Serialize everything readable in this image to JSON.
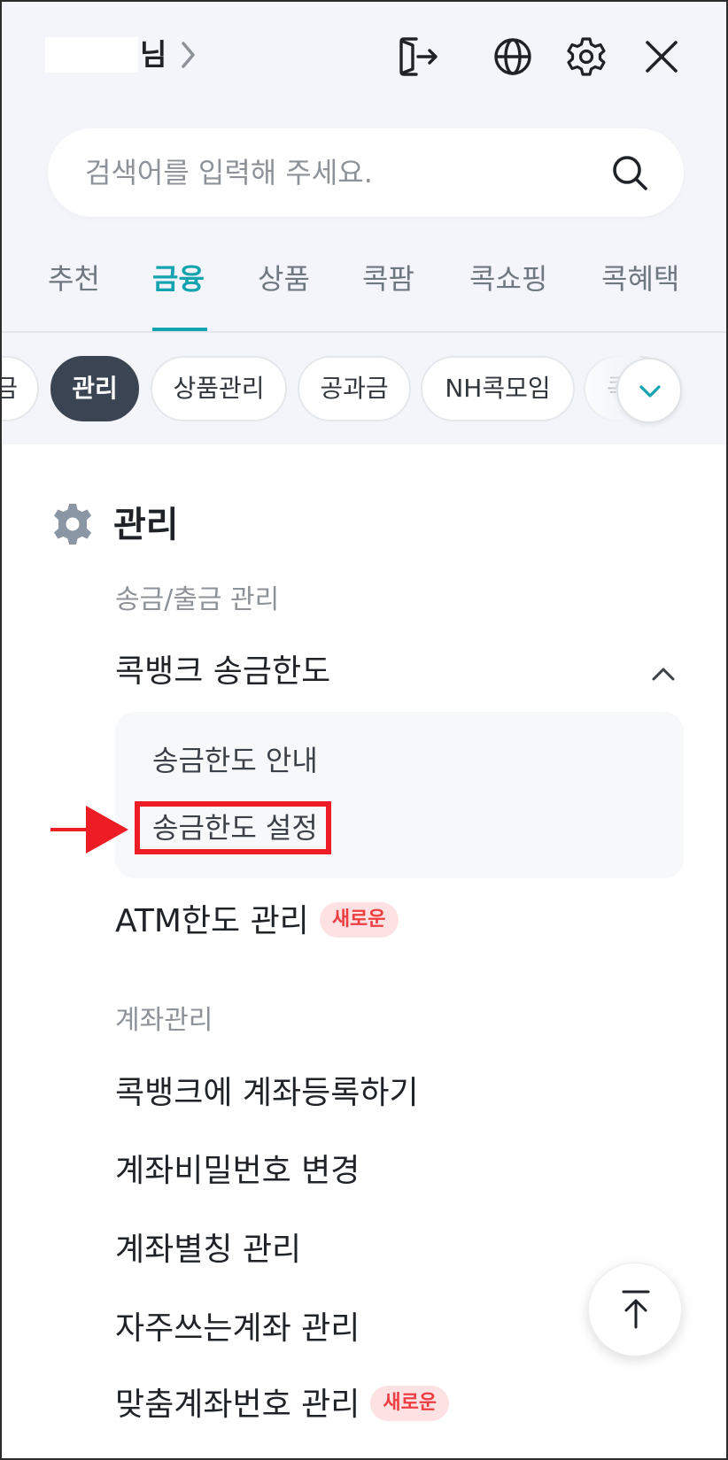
{
  "header": {
    "user_suffix": "님",
    "icons": [
      "logout-icon",
      "globe-icon",
      "settings-icon",
      "close-icon"
    ]
  },
  "search": {
    "placeholder": "검색어를 입력해 주세요."
  },
  "tabs": [
    {
      "label": "추천",
      "active": false
    },
    {
      "label": "금융",
      "active": true
    },
    {
      "label": "상품",
      "active": false
    },
    {
      "label": "콕팜",
      "active": false
    },
    {
      "label": "콕쇼핑",
      "active": false
    },
    {
      "label": "콕혜택",
      "active": false
    }
  ],
  "chips": [
    {
      "label": "금",
      "active": false
    },
    {
      "label": "관리",
      "active": true
    },
    {
      "label": "상품관리",
      "active": false
    },
    {
      "label": "공과금",
      "active": false
    },
    {
      "label": "NH콕모임",
      "active": false
    },
    {
      "label": "콕",
      "active": false
    }
  ],
  "section": {
    "title": "관리",
    "groups": [
      {
        "heading": "송금/출금 관리",
        "items": [
          {
            "label": "콕뱅크 송금한도",
            "expanded": true,
            "children": [
              "송금한도 안내",
              "송금한도 설정"
            ]
          },
          {
            "label": "ATM한도 관리",
            "badge": "새로운"
          }
        ]
      },
      {
        "heading": "계좌관리",
        "items": [
          {
            "label": "콕뱅크에 계좌등록하기"
          },
          {
            "label": "계좌비밀번호 변경"
          },
          {
            "label": "계좌별칭 관리"
          },
          {
            "label": "자주쓰는계좌 관리"
          },
          {
            "label": "맞춤계좌번호 관리",
            "badge": "새로운"
          }
        ]
      }
    ]
  },
  "colors": {
    "accent": "#14a3b1",
    "active_chip": "#3a4452",
    "badge_bg": "#fde1e3",
    "badge_text": "#ef3e42",
    "annotation_red": "#ee1c24"
  }
}
